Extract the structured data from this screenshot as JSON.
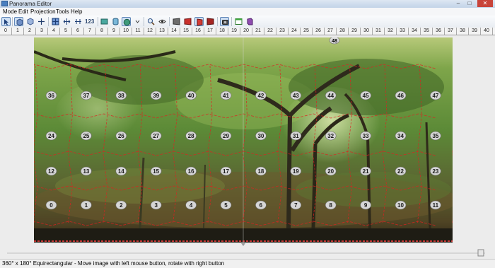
{
  "window": {
    "title": "Panorama Editor",
    "minimize": "–",
    "maximize": "□",
    "close": "✕"
  },
  "menu": [
    "Mode",
    "Edit",
    "Projection",
    "Tools",
    "Help"
  ],
  "toolbar": {
    "counter_label": "123",
    "tools": [
      "select-mode",
      "cube-mode",
      "move-tool",
      "grid-tool",
      "fit-tool",
      "spread-tool",
      "numbering",
      "rect-tool",
      "cylinder-tool",
      "sphere-tool",
      "dropdown",
      "zoom-tool",
      "preview-eye",
      "cube-face-1",
      "cube-face-2",
      "cube-face-3",
      "cube-face-4",
      "camera-tool",
      "window-tool",
      "book-tool"
    ]
  },
  "ruler": {
    "ticks": [
      "0",
      "1",
      "2",
      "3",
      "4",
      "5",
      "6",
      "7",
      "8",
      "9",
      "10",
      "11",
      "12",
      "13",
      "14",
      "15",
      "16",
      "17",
      "18",
      "19",
      "20",
      "21",
      "22",
      "23",
      "24",
      "25",
      "26",
      "27",
      "28",
      "29",
      "30",
      "31",
      "32",
      "33",
      "34",
      "35",
      "36",
      "37",
      "38",
      "39",
      "40"
    ]
  },
  "panorama": {
    "image_labels": [
      "36",
      "37",
      "38",
      "39",
      "40",
      "41",
      "42",
      "43",
      "44",
      "45",
      "46",
      "47",
      "24",
      "25",
      "26",
      "27",
      "28",
      "29",
      "30",
      "31",
      "32",
      "33",
      "34",
      "35",
      "12",
      "13",
      "14",
      "15",
      "16",
      "17",
      "18",
      "19",
      "20",
      "21",
      "22",
      "23",
      "0",
      "1",
      "2",
      "3",
      "4",
      "5",
      "6",
      "7",
      "8",
      "9",
      "10",
      "11"
    ],
    "top_label": "48",
    "bottom_label": "49",
    "overlap_color": "#e02020"
  },
  "status": {
    "text": "360° x 180° Equirectangular - Move image with left mouse button, rotate with right button"
  }
}
